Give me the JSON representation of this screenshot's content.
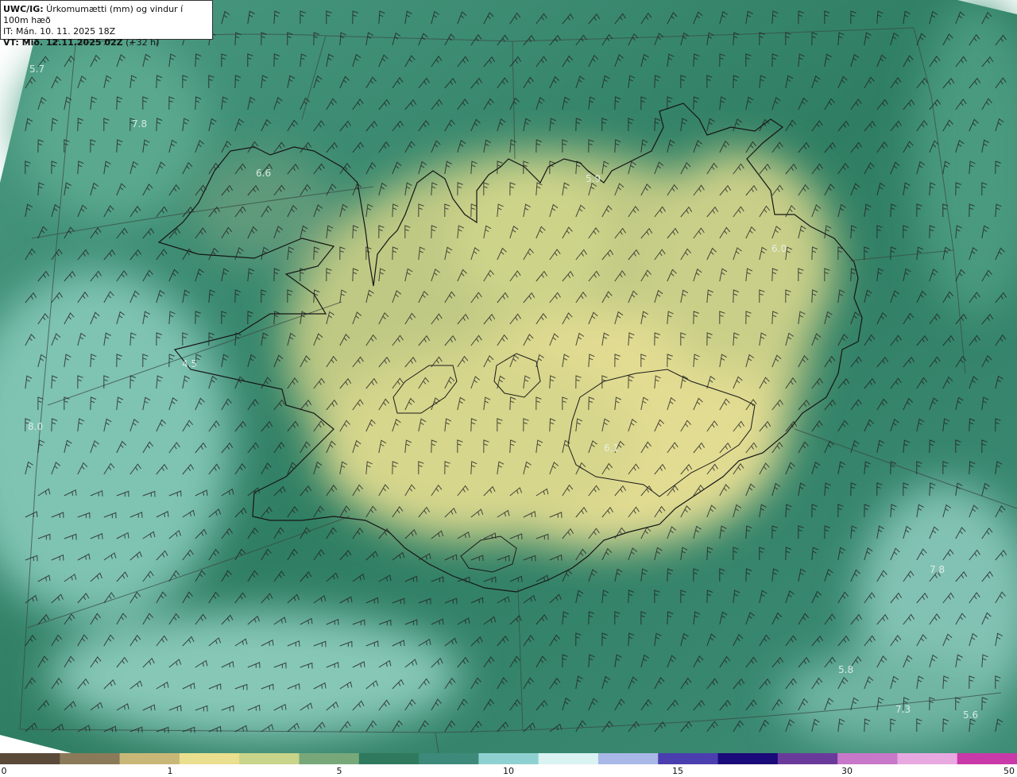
{
  "header": {
    "title_bold": "UWC/IG:",
    "title_rest": " Úrkomumætti (mm) og vindur í 100m hæð",
    "init_time": "IT: Mán. 10. 11. 2025 18Z",
    "valid_bold": "VT: Mið. 12.11.2025 02Z",
    "valid_rest": " (+32 h)"
  },
  "value_labels": [
    "5.7",
    "7.8",
    "6.6",
    "5.9",
    "6.0",
    "4.5",
    "8.0",
    "6.1",
    "5.8",
    "7.3",
    "5.6",
    "7.8"
  ],
  "colorbar": {
    "ticks": [
      "0",
      "1",
      "5",
      "10",
      "15",
      "30",
      "50"
    ],
    "colors": [
      "#5a4a3a",
      "#8a7a5a",
      "#c9b777",
      "#eadf8e",
      "#c8d48a",
      "#78a87a",
      "#2f7a5e",
      "#3e8a7a",
      "#8fd0d0",
      "#d9f2f2",
      "#a9b8e6",
      "#4b3fb0",
      "#1a0a7a",
      "#6a3a9a",
      "#c878c8",
      "#e8a8e0",
      "#c83aa8"
    ]
  },
  "colors": {
    "sea_dark": "#2d7d62",
    "sea_light": "#7cbfaa",
    "land_yellow": "#d8d98a",
    "coastline": "#1a1a1a"
  }
}
